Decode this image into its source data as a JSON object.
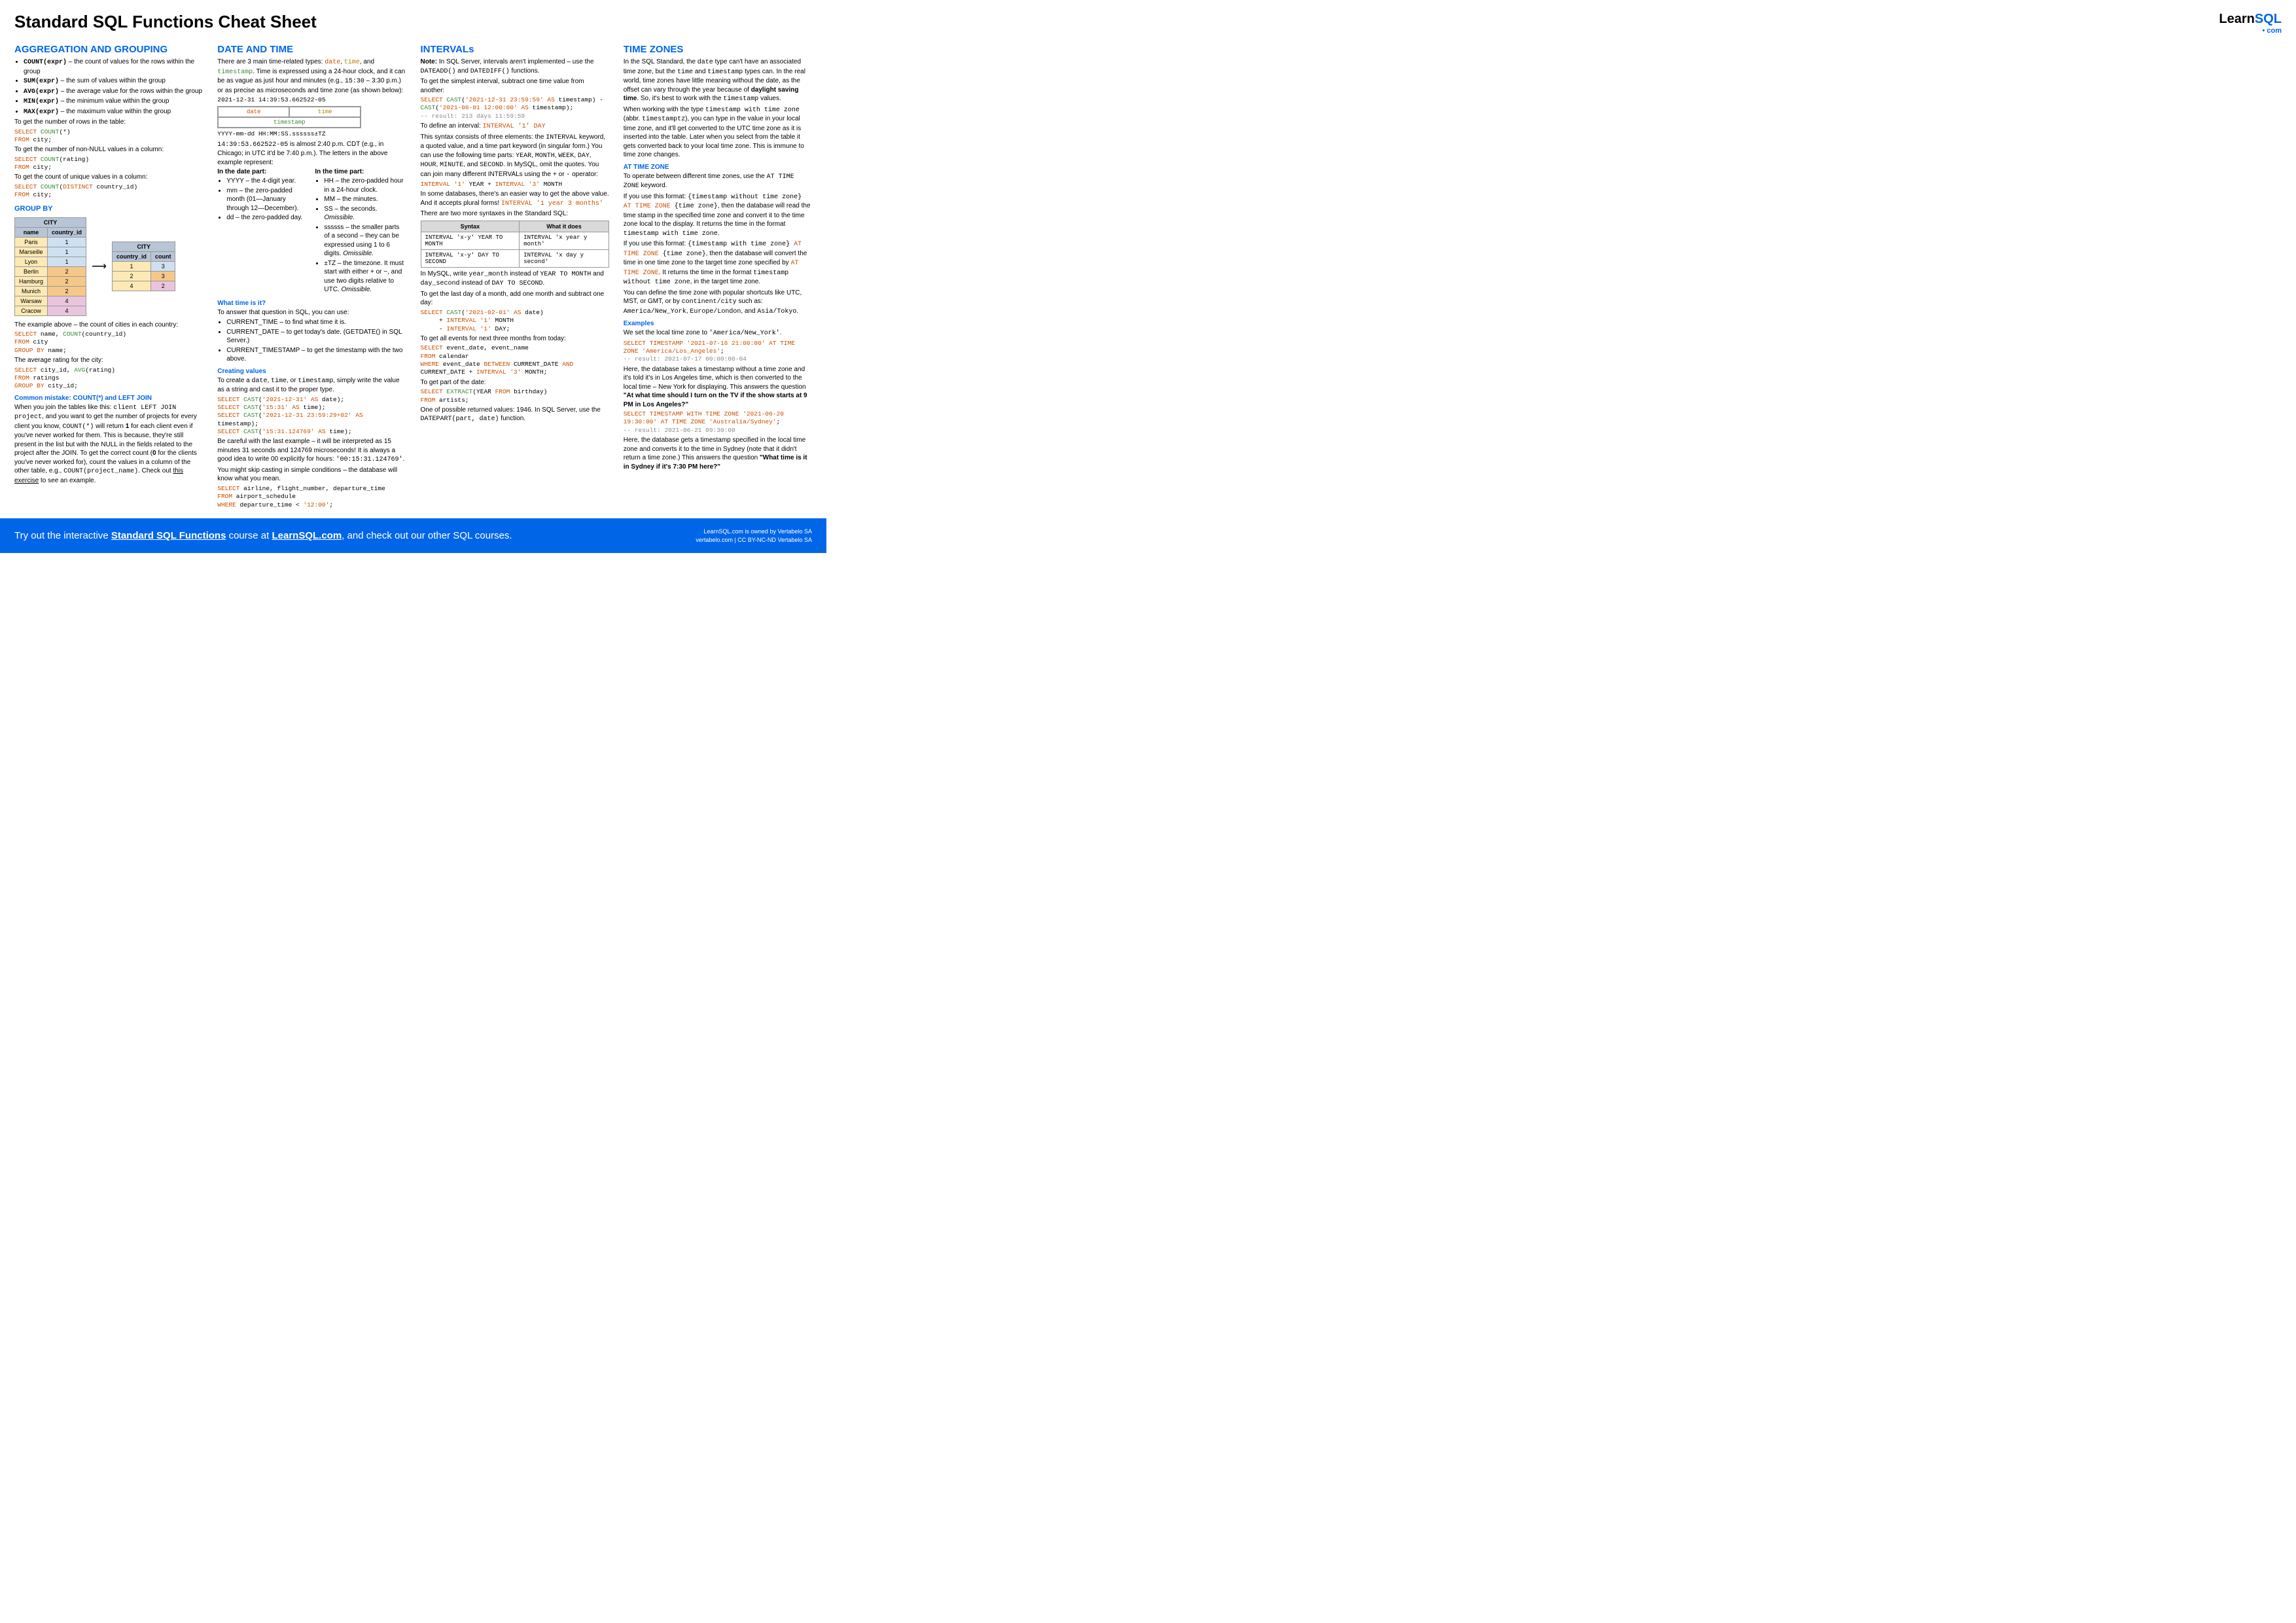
{
  "title": "Standard SQL Functions Cheat Sheet",
  "logo": {
    "learn": "Learn",
    "sql": "SQL",
    "dot": "•",
    "com": "com"
  },
  "col1": {
    "h": "AGGREGATION AND GROUPING",
    "agg": [
      {
        "fn": "COUNT(expr)",
        "d": " – the count of values for the rows within the group"
      },
      {
        "fn": "SUM(expr)",
        "d": " – the sum of values within the group"
      },
      {
        "fn": "AVG(expr)",
        "d": " – the average value for the rows within the group"
      },
      {
        "fn": "MIN(expr)",
        "d": " – the minimum value within the group"
      },
      {
        "fn": "MAX(expr)",
        "d": " – the maximum value within the group"
      }
    ],
    "p1": "To get the number of rows in the table:",
    "q1a": "SELECT",
    "q1b": "COUNT",
    "q1c": "(*)",
    "q1d": "FROM",
    "q1e": " city;",
    "p2": "To get the number of non-NULL values in a column:",
    "q2a": "SELECT",
    "q2b": "COUNT",
    "q2c": "(rating)",
    "q2d": "FROM",
    "q2e": " city;",
    "p3": "To get the count of unique values in a column:",
    "q3a": "SELECT",
    "q3b": "COUNT",
    "q3c": "(",
    "q3d": "DISTINCT",
    "q3e": " country_id)",
    "q3f": "FROM",
    "q3g": " city;",
    "gb": "GROUP BY",
    "t1": {
      "title": "CITY",
      "h1": "name",
      "h2": "country_id",
      "rows": [
        [
          "Paris",
          "1",
          "b"
        ],
        [
          "Marseille",
          "1",
          "b"
        ],
        [
          "Lyon",
          "1",
          "b"
        ],
        [
          "Berlin",
          "2",
          "o"
        ],
        [
          "Hamburg",
          "2",
          "o"
        ],
        [
          "Munich",
          "2",
          "o"
        ],
        [
          "Warsaw",
          "4",
          "p"
        ],
        [
          "Cracow",
          "4",
          "p"
        ]
      ]
    },
    "t2": {
      "title": "CITY",
      "h1": "country_id",
      "h2": "count",
      "rows": [
        [
          "1",
          "3",
          "b"
        ],
        [
          "2",
          "3",
          "o"
        ],
        [
          "4",
          "2",
          "p"
        ]
      ]
    },
    "p4": "The example above – the count of cities in each country:",
    "q4": "SELECT name, COUNT(country_id)\nFROM city\nGROUP BY name;",
    "p5": "The average rating for the city:",
    "q5": "SELECT city_id, AVG(rating)\nFROM ratings\nGROUP BY city_id;",
    "mistake": "Common mistake: COUNT(*) and LEFT JOIN",
    "p6a": "When you join the tables like this: ",
    "p6b": "client LEFT JOIN project",
    "p6c": ", and you want to get the number of projects for every client you know, ",
    "p6d": "COUNT(*)",
    "p6e": " will return ",
    "p6f": "1",
    "p6g": " for each client even if you've never worked for them. This is because, they're still present in the list but with the NULL in the fields related to the project after the JOIN. To get the correct count (",
    "p6h": "0",
    "p6i": " for the clients you've never worked for), count the values in a column of the other table, e.g., ",
    "p6j": "COUNT(project_name)",
    "p6k": ". Check out ",
    "p6l": "this exercise",
    "p6m": " to see an example."
  },
  "col2": {
    "h": "DATE AND TIME",
    "p1a": "There are 3 main time-related types: ",
    "p1b": "date",
    "p1c": ", ",
    "p1d": "time",
    "p1e": ", and ",
    "p1f": "timestamp",
    "p1g": ". Time is expressed using a 24-hour clock, and it can be as vague as just hour and minutes (e.g., ",
    "p1h": "15:30",
    "p1i": " – 3:30 p.m.) or as precise as microseconds and time zone (as shown below):",
    "ts": "2021-12-31 14:39:53.662522-05",
    "lbl_date": "date",
    "lbl_time": "time",
    "lbl_ts": "timestamp",
    "fmt": "YYYY-mm-dd HH:MM:SS.ssssss±TZ",
    "p2a": "14:39:53.662522-05",
    "p2b": " is almost 2:40 p.m. CDT (e.g., in Chicago; in UTC it'd be 7:40 p.m.). The letters in the above example represent:",
    "dph": "In the date part:",
    "tph": "In the time part:",
    "dp": [
      "YYYY – the 4-digit year.",
      "mm – the zero-padded month (01—January through 12—December).",
      "dd – the zero-padded day."
    ],
    "tp": [
      "HH – the zero-padded hour in a 24-hour clock.",
      "MM – the minutes.",
      "SS – the seconds. Omissible.",
      "ssssss – the smaller parts of a second – they can be expressed using 1 to 6 digits. Omissible.",
      "±TZ – the timezone. It must start with either + or −, and use two digits relative to UTC. Omissible."
    ],
    "wt": "What time is it?",
    "p3": "To answer that question in SQL, you can use:",
    "wtl": [
      "CURRENT_TIME – to find what time it is.",
      "CURRENT_DATE – to get today's date. (GETDATE() in SQL Server.)",
      "CURRENT_TIMESTAMP – to get the timestamp with the two above."
    ],
    "cv": "Creating values",
    "p4a": "To create a ",
    "p4b": "date",
    "p4c": ", ",
    "p4d": "time",
    "p4e": ", or ",
    "p4f": "timestamp",
    "p4g": ", simply write the value as a string and cast it to the proper type.",
    "q1": "SELECT CAST('2021-12-31' AS date);\nSELECT CAST('15:31' AS time);\nSELECT CAST('2021-12-31 23:59:29+02' AS timestamp);\nSELECT CAST('15:31.124769' AS time);",
    "p5a": "Be careful with the last example – it will be interpreted as 15 minutes 31 seconds and 124769 microseconds! It is always a good idea to write 00 explicitly for hours: ",
    "p5b": "'00:15:31.124769'",
    "p5c": ".",
    "p6": "You might skip casting in simple conditions – the database will know what you mean.",
    "q2": "SELECT airline, flight_number, departure_time\nFROM airport_schedule\nWHERE departure_time < '12:00';"
  },
  "col3": {
    "h": "INTERVALs",
    "p1a": "Note:",
    "p1b": " In SQL Server, intervals aren't implemented – use the ",
    "p1c": "DATEADD()",
    "p1d": " and ",
    "p1e": "DATEDIFF()",
    "p1f": " functions.",
    "p2": "To get the simplest interval, subtract one time value from another:",
    "q1": "SELECT CAST('2021-12-31 23:59:59' AS timestamp) - CAST('2021-06-01 12:00:00' AS timestamp);",
    "q1r": "-- result: 213 days 11:59:59",
    "p3a": "To define an interval: ",
    "p3b": "INTERVAL '1' DAY",
    "p4a": "This syntax consists of three elements: the ",
    "p4b": "INTERVAL",
    "p4c": " keyword, a quoted value, and a time part keyword (in singular form.) You can use the following time parts: ",
    "p4d": "YEAR",
    "p4e": ", ",
    "p4f": "MONTH",
    "p4g": ", ",
    "p4h": "WEEK",
    "p4i": ", ",
    "p4j": "DAY",
    "p4k": ", ",
    "p4l": "HOUR",
    "p4m": ", ",
    "p4n": "MINUTE",
    "p4o": ", and ",
    "p4p": "SECOND",
    "p4q": ". In MySQL, omit the quotes. You can join many different INTERVALs using the ",
    "p4r": "+",
    "p4s": " or ",
    "p4t": "-",
    "p4u": " operator:",
    "q2": "INTERVAL '1' YEAR + INTERVAL '3' MONTH",
    "p5a": "In some databases, there's an easier way to get the above value. And it accepts plural forms! ",
    "p5b": "INTERVAL '1 year 3 months'",
    "p6": "There are two more syntaxes in the Standard SQL:",
    "th1": "Syntax",
    "th2": "What it does",
    "tr1a": "INTERVAL 'x-y' YEAR TO MONTH",
    "tr1b": "INTERVAL 'x year y month'",
    "tr2a": "INTERVAL 'x-y' DAY TO SECOND",
    "tr2b": "INTERVAL 'x day y second'",
    "p7a": "In MySQL, write ",
    "p7b": "year_month",
    "p7c": " instead of ",
    "p7d": "YEAR TO MONTH",
    "p7e": " and ",
    "p7f": "day_second",
    "p7g": " instead of ",
    "p7h": "DAY TO SECOND",
    "p7i": ".",
    "p8": "To get the last day of a month, add one month and subtract one day:",
    "q3": "SELECT CAST('2021-02-01' AS date)\n     + INTERVAL '1' MONTH\n     - INTERVAL '1' DAY;",
    "p9": "To get all events for next three months from today:",
    "q4": "SELECT event_date, event_name\nFROM calendar\nWHERE event_date BETWEEN CURRENT_DATE AND CURRENT_DATE + INTERVAL '3' MONTH;",
    "p10": "To get part of the date:",
    "q5": "SELECT EXTRACT(YEAR FROM birthday)\nFROM artists;",
    "p11a": "One of possible returned values: 1946. In SQL Server, use the ",
    "p11b": "DATEPART(part, date)",
    "p11c": " function."
  },
  "col4": {
    "h": "TIME ZONES",
    "p1a": "In the SQL Standard, the ",
    "p1b": "date",
    "p1c": " type can't have an associated time zone, but the ",
    "p1d": "time",
    "p1e": " and ",
    "p1f": "timestamp",
    "p1g": " types can. In the real world, time zones have little meaning without the date, as the offset can vary through the year because of ",
    "p1h": "daylight saving time",
    "p1i": ". So, it's best to work with the ",
    "p1j": "timestamp",
    "p1k": " values.",
    "p2a": "When working with the type ",
    "p2b": "timestamp with time zone",
    "p2c": " (abbr. ",
    "p2d": "timestamptz",
    "p2e": "), you can type in the value in your local time zone, and it'll get converted to the UTC time zone as it is inserted into the table. Later when you select from the table it gets converted back to your local time zone. This is immune to time zone changes.",
    "atz": "AT TIME ZONE",
    "p3a": "To operate between different time zones, use the ",
    "p3b": "AT TIME ZONE",
    "p3c": " keyword.",
    "p4a": "If you use this format: ",
    "p4b": "{timestamp without time zone}",
    "p4c": " AT TIME ZONE ",
    "p4d": "{time zone}",
    "p4e": ", then the database will read the time stamp in the specified time zone and convert it to the time zone local to the display. It returns the time in the format ",
    "p4f": "timestamp with time zone",
    "p4g": ".",
    "p5a": "If you use this format: ",
    "p5b": "{timestamp with time zone}",
    "p5c": " AT TIME ZONE ",
    "p5d": "{time zone}",
    "p5e": ", then the database will convert the time in one time zone to the target time zone specified by ",
    "p5f": "AT TIME ZONE",
    "p5g": ". It returns the time in the format ",
    "p5h": "timestamp without time zone",
    "p5i": ", in the target time zone.",
    "p6a": "You can define the time zone with popular shortcuts like UTC, MST, or GMT, or by ",
    "p6b": "continent/city",
    "p6c": " such as: ",
    "p6d": "America/New_York",
    "p6e": ", ",
    "p6f": "Europe/London",
    "p6g": ", and ",
    "p6h": "Asia/Tokyo",
    "p6i": ".",
    "ex": "Examples",
    "p7a": "We set the local time zone to ",
    "p7b": "'America/New_York'",
    "p7c": ".",
    "q1": "SELECT TIMESTAMP '2021-07-16 21:00:00' AT TIME ZONE 'America/Los_Angeles';",
    "q1r": "-- result: 2021-07-17 00:00:00-04",
    "p8a": "Here, the database takes a timestamp without a time zone and it's told it's in Los Angeles time, which is then converted to the local time – New York for displaying. This answers the question ",
    "p8b": "\"At what time should I turn on the TV if the show starts at 9 PM in Los Angeles?\"",
    "q2": "SELECT TIMESTAMP WITH TIME ZONE '2021-06-20 19:30:00' AT TIME ZONE 'Australia/Sydney';",
    "q2r": "-- result: 2021-06-21 09:30:00",
    "p9a": "Here, the database gets a timestamp specified in the local time zone and converts it to the time in Sydney (note that it didn't return a time zone.) This answers the question ",
    "p9b": "\"What time is it in Sydney if it's 7:30 PM here?\""
  },
  "footer": {
    "l1": "Try out the interactive ",
    "l2": "Standard SQL Functions",
    "l3": " course at ",
    "l4": "LearnSQL.com",
    "l5": ", and check out our other SQL courses.",
    "r1": "LearnSQL.com is owned by Vertabelo SA",
    "r2": "vertabelo.com | CC BY-NC-ND Vertabelo SA"
  }
}
